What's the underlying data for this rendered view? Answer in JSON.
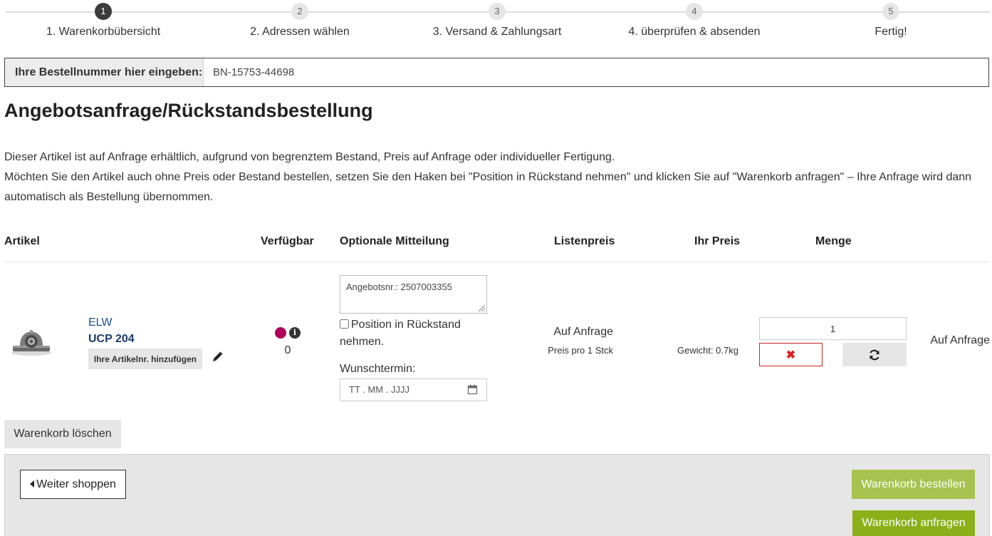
{
  "steps": [
    {
      "num": "1",
      "label": "1. Warenkorbübersicht",
      "active": true
    },
    {
      "num": "2",
      "label": "2. Adressen wählen",
      "active": false
    },
    {
      "num": "3",
      "label": "3. Versand & Zahlungsart",
      "active": false
    },
    {
      "num": "4",
      "label": "4. überprüfen & absenden",
      "active": false
    },
    {
      "num": "5",
      "label": "Fertig!",
      "active": false
    }
  ],
  "order": {
    "label": "Ihre Bestellnummer hier eingeben:",
    "value": "BN-15753-44698"
  },
  "title": "Angebotsanfrage/Rückstandsbestellung",
  "info": {
    "line1": "Dieser Artikel ist auf Anfrage erhältlich, aufgrund von begrenztem Bestand, Preis auf Anfrage oder individueller Fertigung.",
    "line2": "Möchten Sie den Artikel auch ohne Preis oder Bestand bestellen, setzen Sie den Haken bei \"Position in Rückstand nehmen\" und klicken Sie auf \"Warenkorb anfragen\" – Ihre Anfrage wird dann automatisch als Bestellung übernommen."
  },
  "table": {
    "headers": {
      "article": "Artikel",
      "available": "Verfügbar",
      "message": "Optionale Mitteilung",
      "list_price": "Listenpreis",
      "your_price": "Ihr Preis",
      "quantity": "Menge"
    }
  },
  "item": {
    "brand": "ELW",
    "name": "UCP 204",
    "add_article_no": "Ihre Artikelnr. hinzufügen",
    "available_count": "0",
    "availability_color": "#b0005a",
    "message_value": "Angebotsnr.: 2507003355",
    "backorder_label": "Position in Rückstand nehmen.",
    "desired_date_label": "Wunschtermin:",
    "date_placeholder": "TT . MM . JJJJ",
    "list_price": "Auf Anfrage",
    "per_unit": "Preis pro 1 Stck",
    "weight": "Gewicht: 0.7kg",
    "quantity": "1",
    "delete_symbol": "✖",
    "status": "Auf Anfrage"
  },
  "actions": {
    "clear_cart": "Warenkorb löschen",
    "continue_shopping": "Weiter shoppen",
    "order_cart": "Warenkorb bestellen",
    "request_cart": "Warenkorb anfragen"
  },
  "colors": {
    "order_button": "#a7c24f",
    "request_button": "#8bb01a",
    "delete_accent": "#cc2222"
  }
}
